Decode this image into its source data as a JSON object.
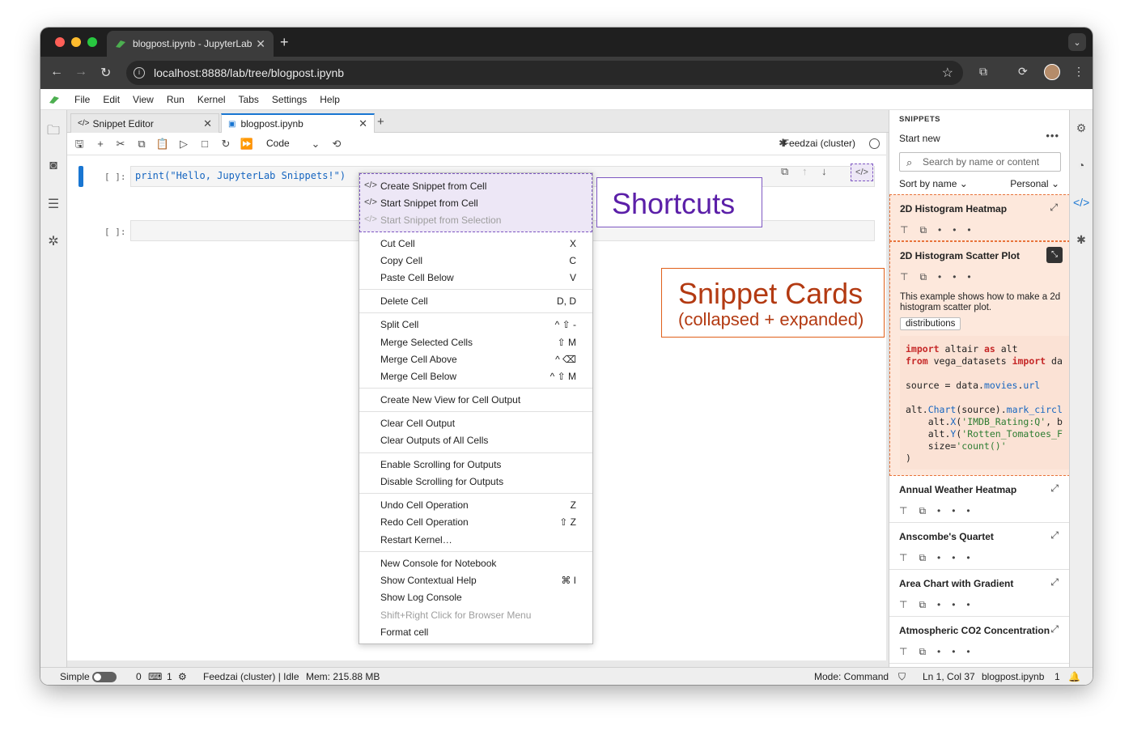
{
  "browser": {
    "tab_title": "blogpost.ipynb - JupyterLab",
    "url": "localhost:8888/lab/tree/blogpost.ipynb"
  },
  "menubar": [
    "File",
    "Edit",
    "View",
    "Run",
    "Kernel",
    "Tabs",
    "Settings",
    "Help"
  ],
  "tabs": [
    {
      "label": "Snippet Editor"
    },
    {
      "label": "blogpost.ipynb"
    }
  ],
  "toolbar": {
    "cell_type": "Code",
    "kernel": "Feedzai (cluster)"
  },
  "cells": [
    {
      "prompt": "[ ]:",
      "code": "print(\"Hello, JupyterLab Snippets!\")"
    },
    {
      "prompt": "[ ]:",
      "code": ""
    }
  ],
  "context_menu": {
    "snippet_items": [
      {
        "label": "Create Snippet from Cell",
        "disabled": false
      },
      {
        "label": "Start Snippet from Cell",
        "disabled": false
      },
      {
        "label": "Start Snippet from Selection",
        "disabled": true
      }
    ],
    "items": [
      {
        "label": "Cut Cell",
        "shortcut": "X"
      },
      {
        "label": "Copy Cell",
        "shortcut": "C"
      },
      {
        "label": "Paste Cell Below",
        "shortcut": "V"
      },
      {
        "label": "Delete Cell",
        "shortcut": "D, D"
      },
      {
        "label": "Split Cell",
        "shortcut": "^ ⇧ -"
      },
      {
        "label": "Merge Selected Cells",
        "shortcut": "⇧ M"
      },
      {
        "label": "Merge Cell Above",
        "shortcut": "^ ⌫"
      },
      {
        "label": "Merge Cell Below",
        "shortcut": "^ ⇧ M"
      },
      {
        "label": "Create New View for Cell Output",
        "shortcut": ""
      },
      {
        "label": "Clear Cell Output",
        "shortcut": ""
      },
      {
        "label": "Clear Outputs of All Cells",
        "shortcut": ""
      },
      {
        "label": "Enable Scrolling for Outputs",
        "shortcut": ""
      },
      {
        "label": "Disable Scrolling for Outputs",
        "shortcut": ""
      },
      {
        "label": "Undo Cell Operation",
        "shortcut": "Z"
      },
      {
        "label": "Redo Cell Operation",
        "shortcut": "⇧ Z"
      },
      {
        "label": "Restart Kernel…",
        "shortcut": ""
      },
      {
        "label": "New Console for Notebook",
        "shortcut": ""
      },
      {
        "label": "Show Contextual Help",
        "shortcut": "⌘ I"
      },
      {
        "label": "Show Log Console",
        "shortcut": ""
      },
      {
        "label": "Shift+Right Click for Browser Menu",
        "shortcut": "",
        "disabled": true
      },
      {
        "label": "Format cell",
        "shortcut": ""
      }
    ]
  },
  "annotations": {
    "shortcuts": "Shortcuts",
    "cards_title": "Snippet Cards",
    "cards_sub": "(collapsed + expanded)"
  },
  "snippets": {
    "header": "SNIPPETS",
    "start_new": "Start new",
    "search_placeholder": "Search by name or content",
    "sort_label": "Sort by name",
    "scope_label": "Personal",
    "cards": [
      {
        "title": "2D Histogram Heatmap"
      },
      {
        "title": "2D Histogram Scatter Plot",
        "description": "This example shows how to make a 2d histogram scatter plot.",
        "tag": "distributions"
      },
      {
        "title": "Annual Weather Heatmap"
      },
      {
        "title": "Anscombe's Quartet"
      },
      {
        "title": "Area Chart with Gradient"
      },
      {
        "title": "Atmospheric CO2 Concentration"
      }
    ]
  },
  "status": {
    "mode_label": "Simple",
    "terminals": "0",
    "kernels": "1",
    "kernel_status": "Feedzai (cluster) | Idle",
    "memory": "Mem: 215.88 MB",
    "mode": "Mode: Command",
    "cursor": "Ln 1, Col 37",
    "file": "blogpost.ipynb",
    "notifications": "1"
  },
  "colors": {
    "accent": "#1976d2",
    "snippet_purple": "#7e57c2",
    "card_orange": "#e8743b"
  }
}
